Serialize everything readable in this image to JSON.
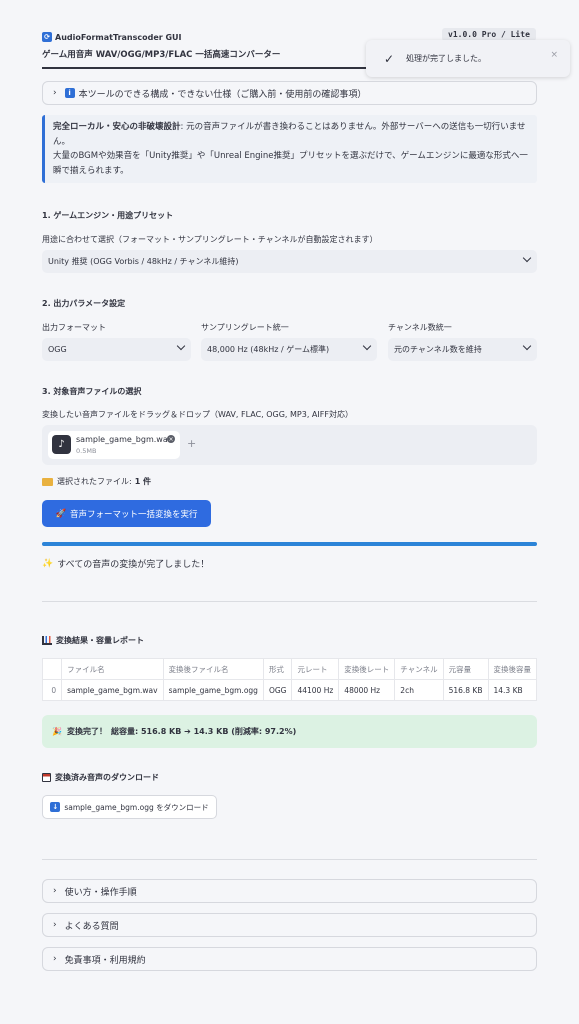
{
  "header": {
    "app_name": "AudioFormatTranscoder GUI",
    "subtitle": "ゲーム用音声 WAV/OGG/MP3/FLAC 一括高速コンバーター",
    "version_badge": "v1.0.0 Pro / Lite"
  },
  "toast": {
    "message": "処理が完了しました。",
    "close_symbol": "×"
  },
  "expander_top": {
    "label": "本ツールのできる構成・できない仕様（ご購入前・使用前の確認事項）"
  },
  "info_box": {
    "bold_text": "完全ローカル・安心の非破壊設計",
    "text_1": ": 元の音声ファイルが書き換わることはありません。外部サーバーへの送信も一切行いません。",
    "text_2": "大量のBGMや効果音を「Unity推奨」や「Unreal Engine推奨」プリセットを選ぶだけで、ゲームエンジンに最適な形式へ一瞬で揃えられます。"
  },
  "section1": {
    "heading": "1. ゲームエンジン・用途プリセット",
    "label": "用途に合わせて選択（フォーマット・サンプリングレート・チャンネルが自動設定されます）",
    "selected": "Unity 推奨 (OGG Vorbis / 48kHz / チャンネル維持)"
  },
  "section2": {
    "heading": "2. 出力パラメータ設定",
    "format_label": "出力フォーマット",
    "format_value": "OGG",
    "rate_label": "サンプリングレート統一",
    "rate_value": "48,000 Hz (48kHz / ゲーム標準)",
    "channel_label": "チャンネル数統一",
    "channel_value": "元のチャンネル数を維持"
  },
  "section3": {
    "heading": "3. 対象音声ファイルの選択",
    "label": "変換したい音声ファイルをドラッグ＆ドロップ（WAV, FLAC, OGG, MP3, AIFF対応）",
    "file_name": "sample_game_bgm.wav",
    "file_size": "0.5MB",
    "add_symbol": "+",
    "selected_prefix": "選択されたファイル:",
    "selected_count": "1 件"
  },
  "run_button": {
    "label": "音声フォーマット一括変換を実行"
  },
  "progress": {
    "value_percent": 100,
    "done_message": "すべての音声の変換が完了しました！"
  },
  "results": {
    "heading": "変換結果・容量レポート",
    "columns": [
      "",
      "ファイル名",
      "変換後ファイル名",
      "形式",
      "元レート",
      "変換後レート",
      "チャンネル",
      "元容量",
      "変換後容量"
    ],
    "rows": [
      [
        "0",
        "sample_game_bgm.wav",
        "sample_game_bgm.ogg",
        "OGG",
        "44100 Hz",
        "48000 Hz",
        "2ch",
        "516.8 KB",
        "14.3 KB"
      ]
    ]
  },
  "success_box": {
    "bold_text": "変換完了！",
    "text": "総容量: 516.8 KB ➔ 14.3 KB (削減率: 97.2%)"
  },
  "download": {
    "heading": "変換済み音声のダウンロード",
    "button_label": "sample_game_bgm.ogg をダウンロード"
  },
  "footer_expanders": [
    {
      "label": "使い方・操作手順"
    },
    {
      "label": "よくある質問"
    },
    {
      "label": "免責事項・利用規約"
    }
  ],
  "colors": {
    "accent": "#2f6fd6",
    "primary_button": "#2f6be0",
    "progress": "#2c84d8",
    "info_bg": "#eaf1fb",
    "success_bg": "#dcf2e3"
  }
}
